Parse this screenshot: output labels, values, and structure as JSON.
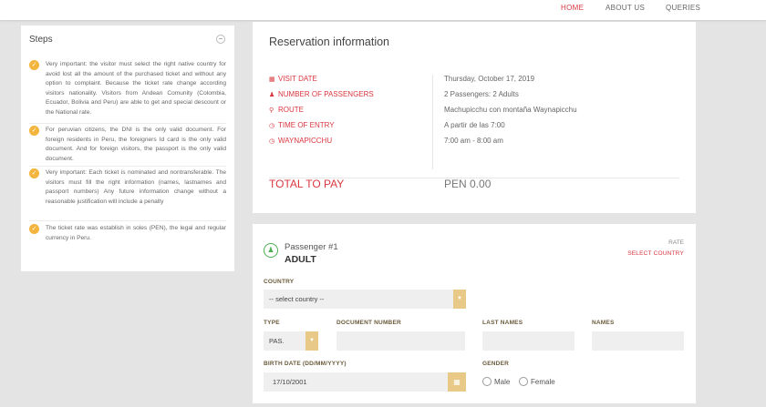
{
  "nav": {
    "home": "HOME",
    "about": "ABOUT US",
    "queries": "QUERIES"
  },
  "steps": {
    "title": "Steps",
    "toggle": "−",
    "items": [
      "Very important: the visitor must select the right native country for avoid lost all the amount of the purchased ticket and without any option to complaint. Because the ticket rate change according visitors nationality. Visitors from Andean Comunity (Colombia, Ecuador, Bolivia and Peru) are able to get and special descount or the National rate.",
      "For peruvian citizens, the DNI is the only valid document. For foreign residents in Peru, the foreigners Id card is the only valid document. And for foreign visitors, the passport is the only valid document.",
      "Very important: Each ticket is nominated and nontransferable. The visitors must fill the right information (names, lastnames and passport numbers) Any future information change without a reasonable justification will include a penalty",
      "The ticket rate was establish in soles (PEN), the legal and regular currency in Peru."
    ]
  },
  "reservation": {
    "title": "Reservation information",
    "rows": [
      {
        "icon": "calendar-icon",
        "label": "VISIT DATE",
        "value": "Thursday, October 17, 2019"
      },
      {
        "icon": "users-icon",
        "label": "NUMBER OF PASSENGERS",
        "value": "2 Passengers: 2 Adults"
      },
      {
        "icon": "map-marker-icon",
        "label": "ROUTE",
        "value": "Machupicchu con montaña Waynapicchu"
      },
      {
        "icon": "clock-icon",
        "label": "TIME OF ENTRY",
        "value": "A partir de las 7:00"
      },
      {
        "icon": "clock-icon",
        "label": "WAYNAPICCHU",
        "value": "7:00 am - 8:00 am"
      }
    ],
    "total_label": "TOTAL TO PAY",
    "total_value": "PEN 0.00"
  },
  "passenger": {
    "number": "Passenger #1",
    "type": "ADULT",
    "rate_label": "RATE",
    "select_country": "SELECT COUNTRY",
    "country_label": "COUNTRY",
    "country_value": "-- select country --",
    "type_label": "TYPE",
    "type_value": "PAS.",
    "document_label": "DOCUMENT NUMBER",
    "document_value": "",
    "lastnames_label": "LAST NAMES",
    "lastnames_value": "",
    "names_label": "NAMES",
    "names_value": "",
    "birth_label": "BIRTH DATE (DD/MM/YYYY)",
    "birth_value": "17/10/2001",
    "gender_label": "GENDER",
    "gender_male": "Male",
    "gender_female": "Female"
  },
  "colors": {
    "accent": "#d9373f",
    "check": "#f3b53d",
    "dropdown": "#e8c987",
    "passenger_icon": "#4caf50"
  }
}
